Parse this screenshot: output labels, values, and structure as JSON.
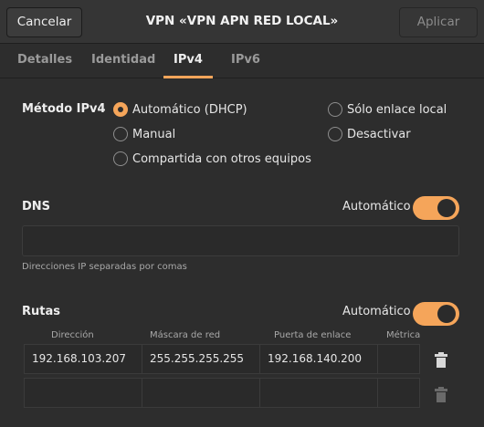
{
  "header": {
    "cancel_label": "Cancelar",
    "title": "VPN «VPN APN RED LOCAL»",
    "apply_label": "Aplicar"
  },
  "tabs": [
    {
      "label": "Detalles",
      "active": false
    },
    {
      "label": "Identidad",
      "active": false
    },
    {
      "label": "IPv4",
      "active": true
    },
    {
      "label": "IPv6",
      "active": false
    }
  ],
  "method": {
    "label": "Método IPv4",
    "options": [
      {
        "label": "Automático (DHCP)",
        "selected": true
      },
      {
        "label": "Manual",
        "selected": false
      },
      {
        "label": "Compartida con otros equipos",
        "selected": false
      },
      {
        "label": "Sólo enlace local",
        "selected": false
      },
      {
        "label": "Desactivar",
        "selected": false
      }
    ]
  },
  "dns": {
    "label": "DNS",
    "auto_label": "Automático",
    "auto_on": true,
    "value": "",
    "hint": "Direcciones IP separadas por comas"
  },
  "routes": {
    "label": "Rutas",
    "auto_label": "Automático",
    "auto_on": true,
    "columns": [
      "Dirección",
      "Máscara de red",
      "Puerta de enlace",
      "Métrica"
    ],
    "rows": [
      [
        "192.168.103.207",
        "255.255.255.255",
        "192.168.140.200",
        ""
      ],
      [
        "",
        "",
        "",
        ""
      ]
    ]
  },
  "colors": {
    "accent": "#f5a55a",
    "background": "#2d2d2d",
    "header": "#353535"
  },
  "icons": [
    "trash-icon"
  ]
}
